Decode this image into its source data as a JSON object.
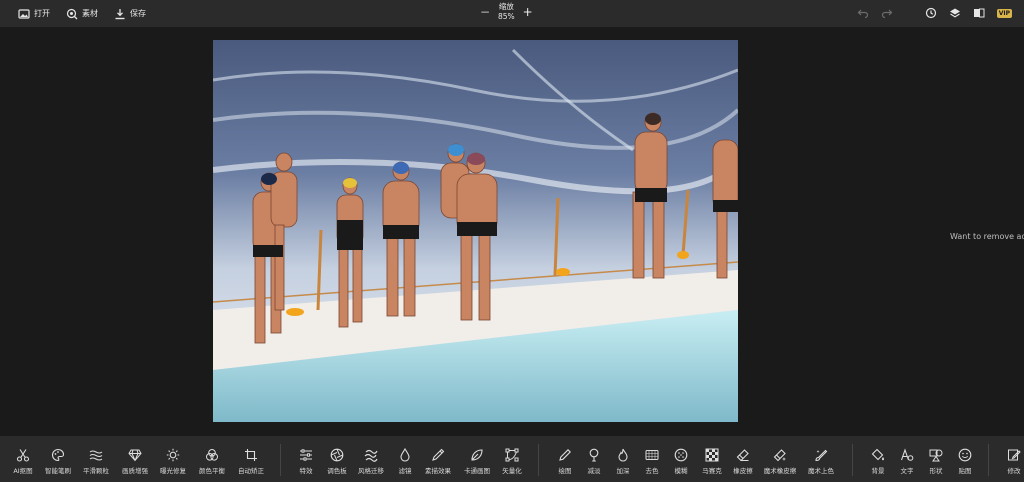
{
  "topbar": {
    "open_label": "打开",
    "assets_label": "素材",
    "save_label": "保存",
    "zoom_minus": "−",
    "zoom_title": "缩放",
    "zoom_value": "85%",
    "zoom_plus": "+",
    "vip_label": "VIP"
  },
  "side_note": "Want to remove ads?",
  "toolbar": {
    "group1": [
      {
        "label": "AI抠图",
        "icon": "scissors-icon"
      },
      {
        "label": "智能笔刷",
        "icon": "palette-brush-icon"
      },
      {
        "label": "平滑颗粒",
        "icon": "waves-icon"
      },
      {
        "label": "画质增强",
        "icon": "diamond-icon"
      },
      {
        "label": "曝光修复",
        "icon": "sun-icon"
      },
      {
        "label": "颜色平衡",
        "icon": "color-circles-icon"
      },
      {
        "label": "自动矫正",
        "icon": "crop-frame-icon"
      }
    ],
    "group2": [
      {
        "label": "特效",
        "icon": "sliders-icon"
      },
      {
        "label": "调色板",
        "icon": "aperture-icon"
      },
      {
        "label": "风格迁移",
        "icon": "style-icon"
      },
      {
        "label": "滤镜",
        "icon": "drop-icon"
      },
      {
        "label": "素描效果",
        "icon": "pencil-line-icon"
      },
      {
        "label": "卡通画图",
        "icon": "leaf-icon"
      },
      {
        "label": "矢量化",
        "icon": "vector-nodes-icon"
      }
    ],
    "group3": [
      {
        "label": "绘图",
        "icon": "pen-icon"
      },
      {
        "label": "减淡",
        "icon": "dodge-icon"
      },
      {
        "label": "加深",
        "icon": "burn-flame-icon"
      },
      {
        "label": "去色",
        "icon": "desaturate-icon"
      },
      {
        "label": "模糊",
        "icon": "blur-dots-icon"
      },
      {
        "label": "马赛克",
        "icon": "mosaic-icon"
      },
      {
        "label": "橡皮擦",
        "icon": "eraser-icon"
      },
      {
        "label": "魔术橡皮擦",
        "icon": "magic-eraser-icon"
      },
      {
        "label": "魔术上色",
        "icon": "magic-brush-icon"
      }
    ],
    "group4": [
      {
        "label": "背景",
        "icon": "paint-bucket-icon"
      },
      {
        "label": "文字",
        "icon": "text-icon"
      },
      {
        "label": "形状",
        "icon": "shapes-icon"
      },
      {
        "label": "贴图",
        "icon": "smiley-icon"
      }
    ],
    "group5": [
      {
        "label": "修改",
        "icon": "edit-icon"
      }
    ]
  }
}
